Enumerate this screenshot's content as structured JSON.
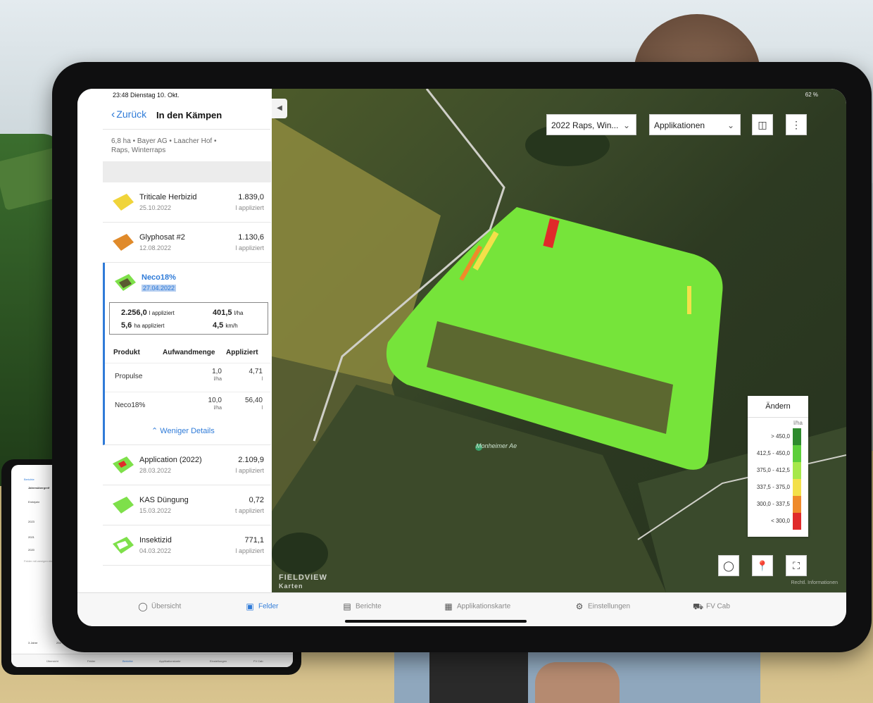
{
  "status": {
    "time": "23:48 Dienstag 10. Okt.",
    "battery": "62 %"
  },
  "nav": {
    "back_label": "Zurück",
    "title": "In den Kämpen"
  },
  "field_meta": {
    "line1": "6,8 ha • Bayer AG • Laacher Hof •",
    "line2": "Raps, Winterraps"
  },
  "applications": [
    {
      "name": "Triticale Herbizid",
      "date": "25.10.2022",
      "value": "1.839,0",
      "unit": "l appliziert",
      "color": "#f0d43a"
    },
    {
      "name": "Glyphosat #2",
      "date": "12.08.2022",
      "value": "1.130,6",
      "unit": "l appliziert",
      "color": "#e08a2a"
    },
    {
      "name": "Neco18%",
      "date": "27.04.2022",
      "color": "#7ee04a"
    },
    {
      "name": "Application (2022)",
      "date": "28.03.2022",
      "value": "2.109,9",
      "unit": "l appliziert",
      "color": "#7ee04a"
    },
    {
      "name": "KAS Düngung",
      "date": "15.03.2022",
      "value": "0,72",
      "unit": "t appliziert",
      "color": "#7ee04a"
    },
    {
      "name": "Insektizid",
      "date": "04.03.2022",
      "value": "771,1",
      "unit": "l appliziert",
      "color": "#7ee04a"
    }
  ],
  "active_stats": {
    "applied_total": "2.256,0",
    "applied_total_unit": "l appliziert",
    "rate": "401,5",
    "rate_unit": "l/ha",
    "area": "5,6",
    "area_unit": "ha appliziert",
    "speed": "4,5",
    "speed_unit": "km/h"
  },
  "product_table": {
    "headers": [
      "Produkt",
      "Aufwandmenge",
      "Appliziert"
    ],
    "rows": [
      {
        "product": "Propulse",
        "rate": "1,0",
        "rate_unit": "l/ha",
        "applied": "4,71",
        "applied_unit": "l"
      },
      {
        "product": "Neco18%",
        "rate": "10,0",
        "rate_unit": "l/ha",
        "applied": "56,40",
        "applied_unit": "l"
      }
    ],
    "less_details": "Weniger Details"
  },
  "map": {
    "season_select": "2022 Raps, Win...",
    "layer_select": "Applikationen",
    "place_label": "Monheimer Ae",
    "watermark": "FIELDVIEW",
    "watermark_sub": "Karten",
    "legal": "Rechtl. Informationen"
  },
  "legend": {
    "change_label": "Ändern",
    "unit": "l/ha",
    "ranges": [
      {
        "label": "> 450,0",
        "color": "#2e8b2e"
      },
      {
        "label": "412,5 - 450,0",
        "color": "#5ccf3a"
      },
      {
        "label": "375,0 - 412,5",
        "color": "#a6e84a"
      },
      {
        "label": "337,5 - 375,0",
        "color": "#f3e04a"
      },
      {
        "label": "300,0 - 337,5",
        "color": "#ef8a2a"
      },
      {
        "label": "< 300,0",
        "color": "#e02a2a"
      }
    ]
  },
  "tabs": [
    {
      "label": "Übersicht",
      "icon": "circle-icon"
    },
    {
      "label": "Felder",
      "icon": "fields-icon",
      "selected": true
    },
    {
      "label": "Berichte",
      "icon": "document-icon"
    },
    {
      "label": "Applikationskarte",
      "icon": "map-grid-icon"
    },
    {
      "label": "Einstellungen",
      "icon": "gear-icon"
    },
    {
      "label": "FV Cab",
      "icon": "tractor-icon"
    }
  ],
  "small_ipad": {
    "back_label": "Berichte",
    "title": "Jahresübergreif",
    "filter": "Erntejahr",
    "years": [
      "2023",
      "2021",
      "2020"
    ],
    "note": "Felder mit wenigen ein",
    "footer_left": "3 Jahre",
    "footer_value": "294",
    "tabs": [
      "Übersicht",
      "Felder",
      "Berichte",
      "Applikationskarte",
      "Einstellungen",
      "FV Cab"
    ]
  }
}
